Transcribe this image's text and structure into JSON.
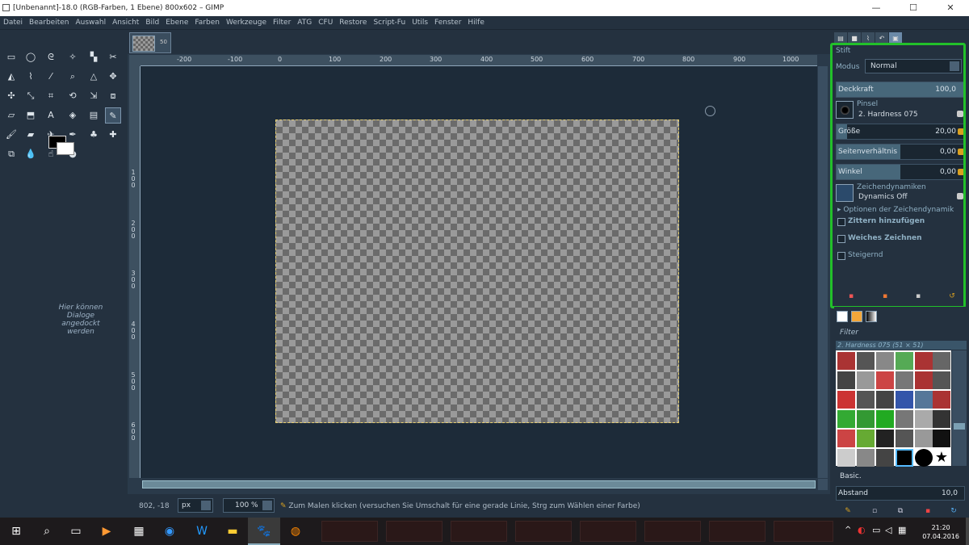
{
  "window": {
    "title": "[Unbenannt]-18.0 (RGB-Farben, 1 Ebene) 800x602 – GIMP",
    "controls": [
      "—",
      "☐",
      "✕"
    ]
  },
  "menu": [
    "Datei",
    "Bearbeiten",
    "Auswahl",
    "Ansicht",
    "Bild",
    "Ebene",
    "Farben",
    "Werkzeuge",
    "Filter",
    "ATG",
    "CFU",
    "Restore",
    "Script-Fu",
    "Utils",
    "Fenster",
    "Hilfe"
  ],
  "toolbox": {
    "dock_hint": "Hier können Dialoge angedockt werden"
  },
  "image_tab": {
    "label": "50"
  },
  "rulers": {
    "h_ticks": [
      "-200",
      "-100",
      "0",
      "100",
      "200",
      "300",
      "400",
      "500",
      "600",
      "700",
      "800",
      "900",
      "1000"
    ],
    "v_ticks": [
      "1 0 0",
      "2 0 0",
      "3 0 0",
      "4 0 0",
      "5 0 0",
      "6 0 0"
    ]
  },
  "status": {
    "coords": "802, -18",
    "unit": "px",
    "zoom": "100 %",
    "message": "Zum Malen klicken (versuchen Sie Umschalt für eine gerade Linie, Strg zum Wählen einer Farbe)"
  },
  "tool_options": {
    "title": "Stift",
    "mode_label": "Modus",
    "mode_value": "Normal",
    "opacity": {
      "label": "Deckkraft",
      "value": "100,0",
      "fraction": 1.0
    },
    "brush_label": "Pinsel",
    "brush_value": "2. Hardness 075",
    "size": {
      "label": "Größe",
      "value": "20,00",
      "fraction": 0.08
    },
    "aspect": {
      "label": "Seitenverhältnis",
      "value": "0,00",
      "fraction": 0.5
    },
    "angle": {
      "label": "Winkel",
      "value": "0,00",
      "fraction": 0.5
    },
    "dynamics_label": "Zeichendynamiken",
    "dynamics_value": "Dynamics Off",
    "dynamics_options": "Optionen der Zeichendynamik",
    "jitter": "Zittern hinzufügen",
    "smooth": "Weiches Zeichnen",
    "incremental": "Steigernd"
  },
  "brushes": {
    "filter": "Filter",
    "selected_title": "2. Hardness 075 (51 × 51)",
    "tag": "Basic.",
    "spacing_label": "Abstand",
    "spacing_value": "10,0"
  },
  "taskbar": {
    "time": "21:20",
    "date": "07.04.2016"
  }
}
